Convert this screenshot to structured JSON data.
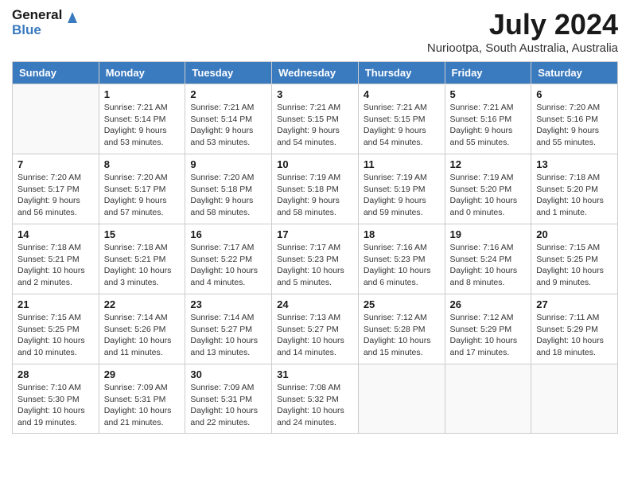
{
  "header": {
    "logo_general": "General",
    "logo_blue": "Blue",
    "title": "July 2024",
    "location": "Nuriootpa, South Australia, Australia"
  },
  "days_of_week": [
    "Sunday",
    "Monday",
    "Tuesday",
    "Wednesday",
    "Thursday",
    "Friday",
    "Saturday"
  ],
  "weeks": [
    [
      {
        "day": "",
        "info": ""
      },
      {
        "day": "1",
        "info": "Sunrise: 7:21 AM\nSunset: 5:14 PM\nDaylight: 9 hours\nand 53 minutes."
      },
      {
        "day": "2",
        "info": "Sunrise: 7:21 AM\nSunset: 5:14 PM\nDaylight: 9 hours\nand 53 minutes."
      },
      {
        "day": "3",
        "info": "Sunrise: 7:21 AM\nSunset: 5:15 PM\nDaylight: 9 hours\nand 54 minutes."
      },
      {
        "day": "4",
        "info": "Sunrise: 7:21 AM\nSunset: 5:15 PM\nDaylight: 9 hours\nand 54 minutes."
      },
      {
        "day": "5",
        "info": "Sunrise: 7:21 AM\nSunset: 5:16 PM\nDaylight: 9 hours\nand 55 minutes."
      },
      {
        "day": "6",
        "info": "Sunrise: 7:20 AM\nSunset: 5:16 PM\nDaylight: 9 hours\nand 55 minutes."
      }
    ],
    [
      {
        "day": "7",
        "info": "Sunrise: 7:20 AM\nSunset: 5:17 PM\nDaylight: 9 hours\nand 56 minutes."
      },
      {
        "day": "8",
        "info": "Sunrise: 7:20 AM\nSunset: 5:17 PM\nDaylight: 9 hours\nand 57 minutes."
      },
      {
        "day": "9",
        "info": "Sunrise: 7:20 AM\nSunset: 5:18 PM\nDaylight: 9 hours\nand 58 minutes."
      },
      {
        "day": "10",
        "info": "Sunrise: 7:19 AM\nSunset: 5:18 PM\nDaylight: 9 hours\nand 58 minutes."
      },
      {
        "day": "11",
        "info": "Sunrise: 7:19 AM\nSunset: 5:19 PM\nDaylight: 9 hours\nand 59 minutes."
      },
      {
        "day": "12",
        "info": "Sunrise: 7:19 AM\nSunset: 5:20 PM\nDaylight: 10 hours\nand 0 minutes."
      },
      {
        "day": "13",
        "info": "Sunrise: 7:18 AM\nSunset: 5:20 PM\nDaylight: 10 hours\nand 1 minute."
      }
    ],
    [
      {
        "day": "14",
        "info": "Sunrise: 7:18 AM\nSunset: 5:21 PM\nDaylight: 10 hours\nand 2 minutes."
      },
      {
        "day": "15",
        "info": "Sunrise: 7:18 AM\nSunset: 5:21 PM\nDaylight: 10 hours\nand 3 minutes."
      },
      {
        "day": "16",
        "info": "Sunrise: 7:17 AM\nSunset: 5:22 PM\nDaylight: 10 hours\nand 4 minutes."
      },
      {
        "day": "17",
        "info": "Sunrise: 7:17 AM\nSunset: 5:23 PM\nDaylight: 10 hours\nand 5 minutes."
      },
      {
        "day": "18",
        "info": "Sunrise: 7:16 AM\nSunset: 5:23 PM\nDaylight: 10 hours\nand 6 minutes."
      },
      {
        "day": "19",
        "info": "Sunrise: 7:16 AM\nSunset: 5:24 PM\nDaylight: 10 hours\nand 8 minutes."
      },
      {
        "day": "20",
        "info": "Sunrise: 7:15 AM\nSunset: 5:25 PM\nDaylight: 10 hours\nand 9 minutes."
      }
    ],
    [
      {
        "day": "21",
        "info": "Sunrise: 7:15 AM\nSunset: 5:25 PM\nDaylight: 10 hours\nand 10 minutes."
      },
      {
        "day": "22",
        "info": "Sunrise: 7:14 AM\nSunset: 5:26 PM\nDaylight: 10 hours\nand 11 minutes."
      },
      {
        "day": "23",
        "info": "Sunrise: 7:14 AM\nSunset: 5:27 PM\nDaylight: 10 hours\nand 13 minutes."
      },
      {
        "day": "24",
        "info": "Sunrise: 7:13 AM\nSunset: 5:27 PM\nDaylight: 10 hours\nand 14 minutes."
      },
      {
        "day": "25",
        "info": "Sunrise: 7:12 AM\nSunset: 5:28 PM\nDaylight: 10 hours\nand 15 minutes."
      },
      {
        "day": "26",
        "info": "Sunrise: 7:12 AM\nSunset: 5:29 PM\nDaylight: 10 hours\nand 17 minutes."
      },
      {
        "day": "27",
        "info": "Sunrise: 7:11 AM\nSunset: 5:29 PM\nDaylight: 10 hours\nand 18 minutes."
      }
    ],
    [
      {
        "day": "28",
        "info": "Sunrise: 7:10 AM\nSunset: 5:30 PM\nDaylight: 10 hours\nand 19 minutes."
      },
      {
        "day": "29",
        "info": "Sunrise: 7:09 AM\nSunset: 5:31 PM\nDaylight: 10 hours\nand 21 minutes."
      },
      {
        "day": "30",
        "info": "Sunrise: 7:09 AM\nSunset: 5:31 PM\nDaylight: 10 hours\nand 22 minutes."
      },
      {
        "day": "31",
        "info": "Sunrise: 7:08 AM\nSunset: 5:32 PM\nDaylight: 10 hours\nand 24 minutes."
      },
      {
        "day": "",
        "info": ""
      },
      {
        "day": "",
        "info": ""
      },
      {
        "day": "",
        "info": ""
      }
    ]
  ]
}
